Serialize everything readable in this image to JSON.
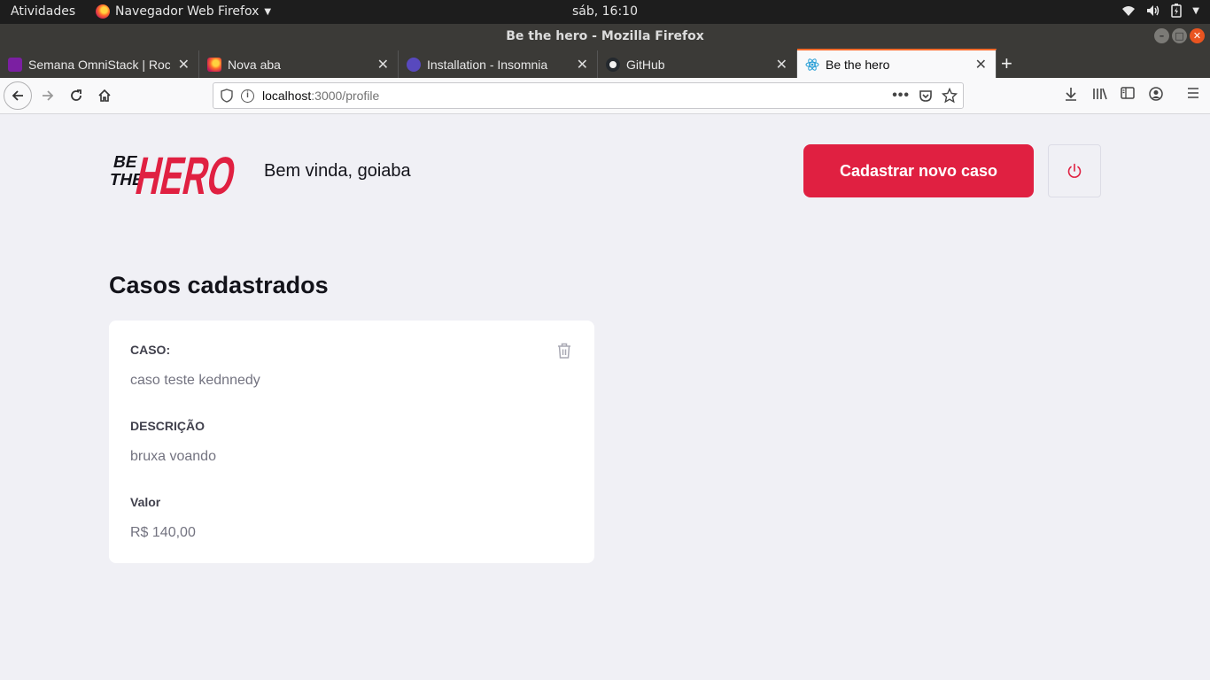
{
  "system": {
    "activities": "Atividades",
    "app_name": "Navegador Web Firefox",
    "clock": "sáb, 16:10"
  },
  "window": {
    "title": "Be the hero - Mozilla Firefox"
  },
  "tabs": [
    {
      "label": "Semana OmniStack | Rocketseat",
      "favicon_color": "#7b1fa2"
    },
    {
      "label": "Nova aba",
      "favicon_color": "#ff6b2b"
    },
    {
      "label": "Installation - Insomnia",
      "favicon_color": "#5849be"
    },
    {
      "label": "GitHub",
      "favicon_color": "#24292e"
    },
    {
      "label": "Be the hero",
      "favicon_color": "#61dafb",
      "active": true
    }
  ],
  "urlbar": {
    "host": "localhost",
    "rest": ":3000/profile"
  },
  "page": {
    "logo": {
      "be": "BE",
      "the": "THE",
      "hero": "HERO"
    },
    "greeting": "Bem vinda, goiaba",
    "new_case_button": "Cadastrar novo caso",
    "section_title": "Casos cadastrados",
    "incident": {
      "case_label": "CASO:",
      "case_value": "caso teste kednnedy",
      "description_label": "DESCRIÇÃO",
      "description_value": "bruxa voando",
      "value_label": "Valor",
      "value_value": "R$ 140,00"
    }
  },
  "colors": {
    "brand": "#e02041",
    "background": "#f0f0f5",
    "card": "#ffffff",
    "label": "#41414d",
    "muted": "#737380"
  }
}
